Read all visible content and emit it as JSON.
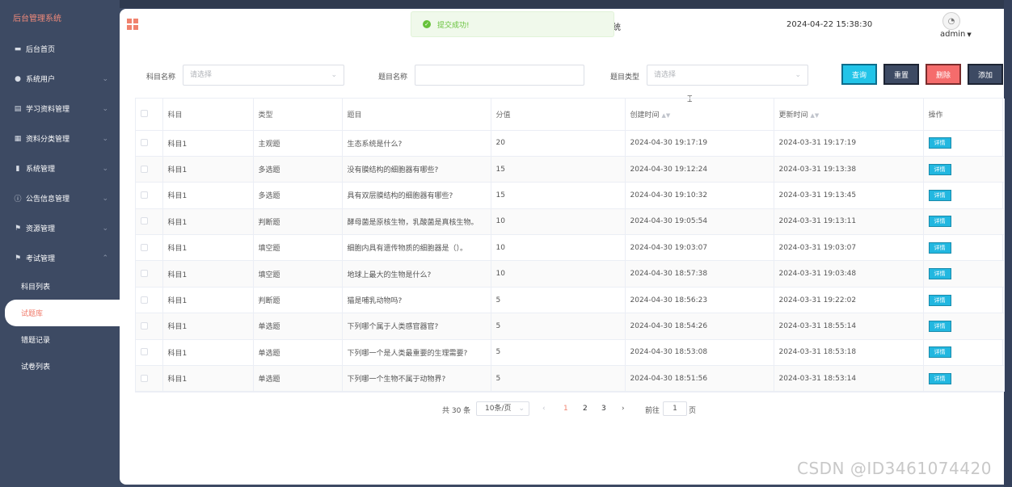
{
  "sidebar": {
    "brand": "后台管理系统",
    "items": [
      {
        "label": "后台首页",
        "icon": "monitor-icon",
        "glyph": "▬"
      },
      {
        "label": "系统用户",
        "icon": "user-icon",
        "glyph": "●"
      },
      {
        "label": "学习资料管理",
        "icon": "book-icon",
        "glyph": "▤"
      },
      {
        "label": "资料分类管理",
        "icon": "folder-icon",
        "glyph": "▦"
      },
      {
        "label": "系统管理",
        "icon": "bar-chart-icon",
        "glyph": "▮"
      },
      {
        "label": "公告信息管理",
        "icon": "info-icon",
        "glyph": "ⓘ"
      },
      {
        "label": "资源管理",
        "icon": "flag-icon",
        "glyph": "⚑"
      },
      {
        "label": "考试管理",
        "icon": "flag-icon",
        "glyph": "⚑"
      }
    ],
    "submenu": [
      "科目列表",
      "试题库",
      "错题记录",
      "试卷列表"
    ]
  },
  "header": {
    "title_tail": "统",
    "datetime": "2024-04-22 15:38:30",
    "user": "admin"
  },
  "toast": {
    "message": "提交成功!"
  },
  "search": {
    "subject_label": "科目名称",
    "subject_placeholder": "请选择",
    "question_label": "题目名称",
    "question_value": "",
    "type_label": "题目类型",
    "type_placeholder": "请选择",
    "buttons": {
      "query": "查询",
      "reset": "重置",
      "delete": "删除",
      "add": "添加"
    }
  },
  "table": {
    "headers": [
      "科目",
      "类型",
      "题目",
      "分值",
      "创建时间",
      "更新时间",
      "操作"
    ],
    "action_label": "详情",
    "rows": [
      {
        "subject": "科目1",
        "type": "主观题",
        "question": "生态系统是什么?",
        "score": "20",
        "created": "2024-04-30 19:17:19",
        "updated": "2024-03-31 19:17:19"
      },
      {
        "subject": "科目1",
        "type": "多选题",
        "question": "没有膜结构的细胞器有哪些?",
        "score": "15",
        "created": "2024-04-30 19:12:24",
        "updated": "2024-03-31 19:13:38"
      },
      {
        "subject": "科目1",
        "type": "多选题",
        "question": "具有双层膜结构的细胞器有哪些?",
        "score": "15",
        "created": "2024-04-30 19:10:32",
        "updated": "2024-03-31 19:13:45"
      },
      {
        "subject": "科目1",
        "type": "判断题",
        "question": "酵母菌是原核生物，乳酸菌是真核生物。",
        "score": "10",
        "created": "2024-04-30 19:05:54",
        "updated": "2024-03-31 19:13:11"
      },
      {
        "subject": "科目1",
        "type": "填空题",
        "question": "细胞内具有遗传物质的细胞器是（）。",
        "score": "10",
        "created": "2024-04-30 19:03:07",
        "updated": "2024-03-31 19:03:07"
      },
      {
        "subject": "科目1",
        "type": "填空题",
        "question": "地球上最大的生物是什么?",
        "score": "10",
        "created": "2024-04-30 18:57:38",
        "updated": "2024-03-31 19:03:48"
      },
      {
        "subject": "科目1",
        "type": "判断题",
        "question": "猫是哺乳动物吗?",
        "score": "5",
        "created": "2024-04-30 18:56:23",
        "updated": "2024-03-31 19:22:02"
      },
      {
        "subject": "科目1",
        "type": "单选题",
        "question": "下列哪个属于人类感官器官?",
        "score": "5",
        "created": "2024-04-30 18:54:26",
        "updated": "2024-03-31 18:55:14"
      },
      {
        "subject": "科目1",
        "type": "单选题",
        "question": "下列哪一个是人类最重要的生理需要?",
        "score": "5",
        "created": "2024-04-30 18:53:08",
        "updated": "2024-03-31 18:53:18"
      },
      {
        "subject": "科目1",
        "type": "单选题",
        "question": "下列哪一个生物不属于动物界?",
        "score": "5",
        "created": "2024-04-30 18:51:56",
        "updated": "2024-03-31 18:53:14"
      }
    ]
  },
  "pager": {
    "total": "共 30 条",
    "page_size": "10条/页",
    "pages": [
      "1",
      "2",
      "3"
    ],
    "current": "1",
    "goto_label": "前往",
    "goto_value": "1",
    "page_unit": "页"
  },
  "watermark": "CSDN @ID3461074420",
  "colors": {
    "sidebar": "#3d4a63",
    "accent": "#f0826e",
    "query": "#22c4e8",
    "delete": "#f56c6c",
    "success": "#67c23a"
  }
}
